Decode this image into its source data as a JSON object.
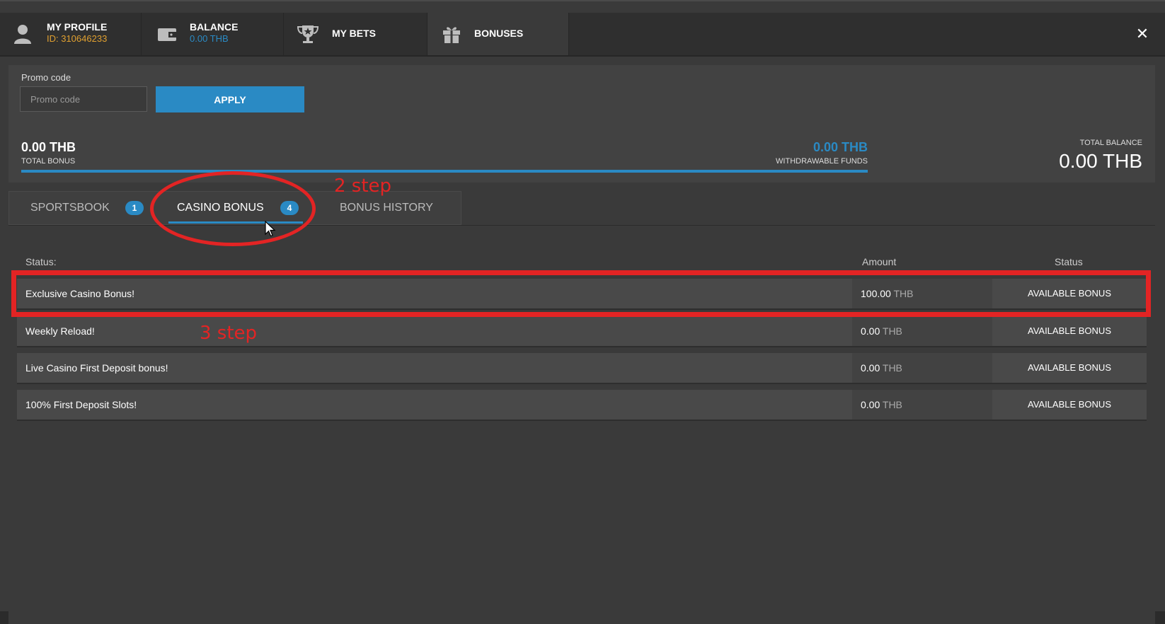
{
  "header": {
    "tabs": [
      {
        "icon": "user-icon",
        "title": "MY PROFILE",
        "subtitle": "ID: 310646233",
        "subtitle_color": "#e0a030"
      },
      {
        "icon": "wallet-icon",
        "title": "BALANCE",
        "subtitle": "0.00 THB",
        "subtitle_color": "#2a8ac4"
      },
      {
        "icon": "trophy-icon",
        "title": "MY BETS"
      },
      {
        "icon": "gift-icon",
        "title": "BONUSES",
        "active": true
      }
    ],
    "close_glyph": "✕"
  },
  "promo": {
    "label": "Promo code",
    "placeholder": "Promo code",
    "value": "",
    "apply_label": "APPLY"
  },
  "summary": {
    "total_bonus_value": "0.00 THB",
    "total_bonus_label": "TOTAL BONUS",
    "withdrawable_value": "0.00 THB",
    "withdrawable_label": "WITHDRAWABLE FUNDS",
    "total_balance_label": "TOTAL BALANCE",
    "total_balance_value": "0.00 THB"
  },
  "subtabs": [
    {
      "label": "SPORTSBOOK",
      "badge": "1"
    },
    {
      "label": "CASINO BONUS",
      "badge": "4",
      "active": true
    },
    {
      "label": "BONUS HISTORY"
    }
  ],
  "table": {
    "headers": {
      "status": "Status:",
      "amount": "Amount",
      "status_col": "Status"
    },
    "rows": [
      {
        "name": "Exclusive Casino Bonus!",
        "amount": "100.00",
        "currency": "THB",
        "status": "AVAILABLE BONUS"
      },
      {
        "name": "Weekly Reload!",
        "amount": "0.00",
        "currency": "THB",
        "status": "AVAILABLE BONUS"
      },
      {
        "name": "Live Casino First Deposit bonus!",
        "amount": "0.00",
        "currency": "THB",
        "status": "AVAILABLE BONUS"
      },
      {
        "name": "100% First Deposit Slots!",
        "amount": "0.00",
        "currency": "THB",
        "status": "AVAILABLE BONUS"
      }
    ]
  },
  "annotations": {
    "step2": "2 step",
    "step3": "3 step",
    "color": "#e32424"
  },
  "colors": {
    "accent": "#2a8ac4",
    "id_color": "#e0a030"
  }
}
